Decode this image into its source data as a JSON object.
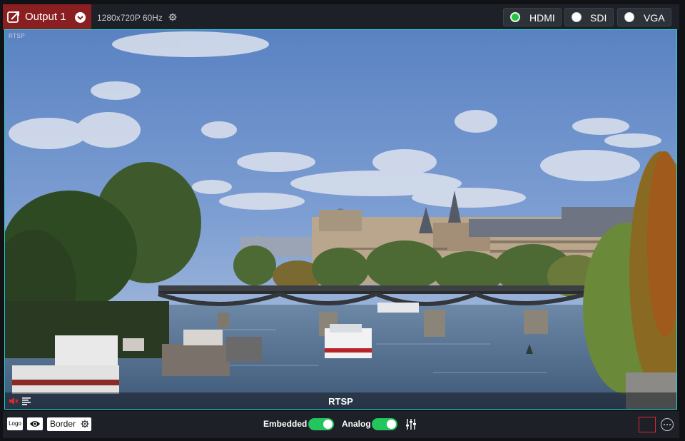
{
  "header": {
    "output_title": "Output 1",
    "resolution": "1280x720P 60Hz",
    "signals": [
      {
        "label": "HDMI",
        "active": true
      },
      {
        "label": "SDI",
        "active": false
      },
      {
        "label": "VGA",
        "active": false
      }
    ]
  },
  "preview": {
    "corner_tag": "RTSP",
    "source_label": "RTSP"
  },
  "footer": {
    "logo_label": "Logo",
    "border_label": "Border",
    "embedded_label": "Embedded",
    "embedded_on": true,
    "analog_label": "Analog",
    "analog_on": true
  },
  "colors": {
    "accent_tab": "#8a1f22",
    "active_signal": "#23c440",
    "toggle_on": "#22c55e",
    "preview_border": "#2ad0d6",
    "outline_red": "#e0262f"
  },
  "icons": [
    "edit-icon",
    "chevron-down-icon",
    "gear-icon",
    "mute-icon",
    "audio-meter-icon",
    "eye-icon",
    "mixer-sliders-icon",
    "more-icon"
  ]
}
